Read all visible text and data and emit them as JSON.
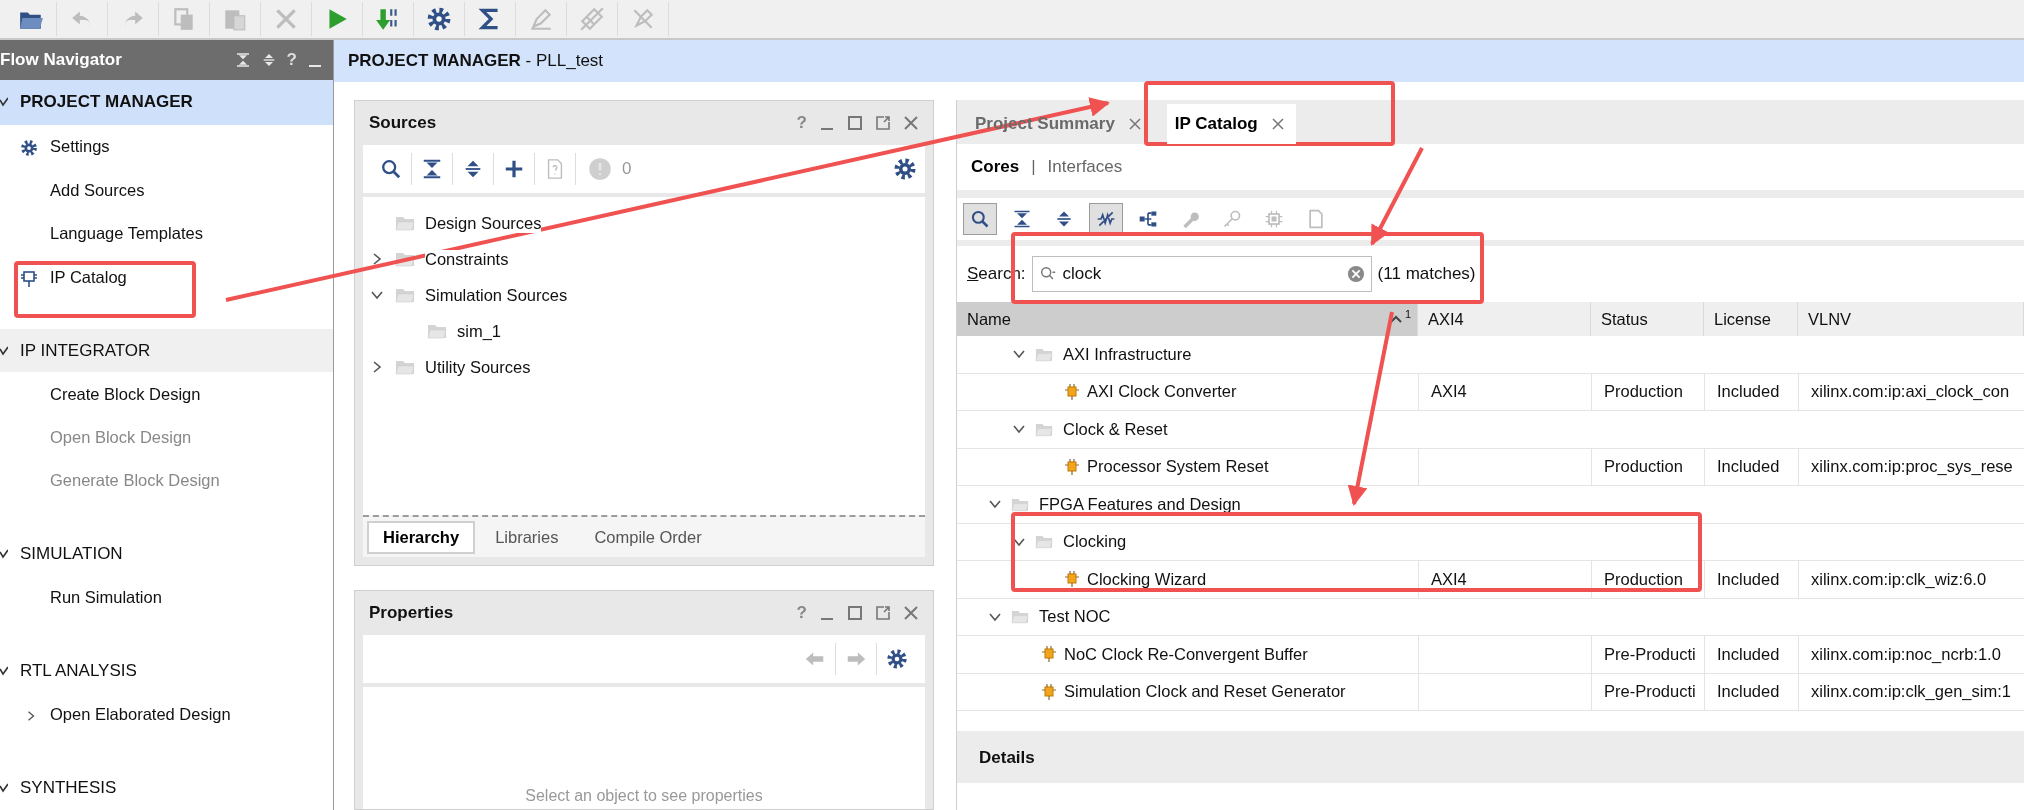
{
  "toolbar": [
    {
      "kind": "folder",
      "disabled": false
    },
    {
      "kind": "undo",
      "disabled": true
    },
    {
      "kind": "redo",
      "disabled": true
    },
    {
      "kind": "copy",
      "disabled": true
    },
    {
      "kind": "paste",
      "disabled": true
    },
    {
      "kind": "delete",
      "disabled": true
    },
    {
      "kind": "run",
      "disabled": false
    },
    {
      "kind": "bitstream",
      "disabled": false
    },
    {
      "kind": "settings",
      "disabled": false
    },
    {
      "kind": "sigma",
      "disabled": false
    },
    {
      "kind": "edit",
      "disabled": true
    },
    {
      "kind": "tag",
      "disabled": true
    },
    {
      "kind": "cut",
      "disabled": true
    }
  ],
  "flow_navigator": {
    "title": "Flow Navigator",
    "help": "?",
    "sections": [
      {
        "title": "PROJECT MANAGER",
        "expanded": true,
        "selected": true,
        "hovered": false,
        "items": [
          {
            "label": "Settings",
            "kind": "settings",
            "disabled": false
          },
          {
            "label": "Add Sources",
            "kind": "action",
            "disabled": false
          },
          {
            "label": "Language Templates",
            "kind": "action",
            "disabled": false
          },
          {
            "label": "IP Catalog",
            "kind": "catalog",
            "disabled": false
          }
        ]
      },
      {
        "title": "IP INTEGRATOR",
        "expanded": true,
        "selected": false,
        "hovered": true,
        "items": [
          {
            "label": "Create Block Design",
            "kind": "action",
            "disabled": false
          },
          {
            "label": "Open Block Design",
            "kind": "action",
            "disabled": true
          },
          {
            "label": "Generate Block Design",
            "kind": "action",
            "disabled": true
          }
        ]
      },
      {
        "title": "SIMULATION",
        "expanded": true,
        "selected": false,
        "hovered": false,
        "items": [
          {
            "label": "Run Simulation",
            "kind": "action",
            "disabled": false
          }
        ]
      },
      {
        "title": "RTL ANALYSIS",
        "expanded": true,
        "selected": false,
        "hovered": false,
        "items": [
          {
            "label": "Open Elaborated Design",
            "kind": "action",
            "disabled": false,
            "expanded": false
          }
        ]
      },
      {
        "title": "SYNTHESIS",
        "expanded": true,
        "selected": false,
        "hovered": false
      }
    ]
  },
  "header": {
    "title": "**PROJECT MANAGER** - PLL_test"
  },
  "sources": {
    "title": "Sources",
    "help": "?",
    "toolbar": [
      {
        "kind": "search",
        "disabled": false
      },
      {
        "kind": "collapse",
        "disabled": false
      },
      {
        "kind": "expand",
        "disabled": false
      },
      {
        "kind": "add",
        "disabled": false
      },
      {
        "kind": "unknown",
        "disabled": true
      }
    ],
    "message_count": "0",
    "tree": [
      {
        "label": "Design Sources"
      },
      {
        "label": "Constraints",
        "expanded": false
      },
      {
        "label": "Simulation Sources",
        "expanded": true,
        "children": [
          {
            "label": "sim_1"
          }
        ]
      },
      {
        "label": "Utility Sources",
        "expanded": false
      }
    ],
    "tabs": [
      {
        "label": "Hierarchy",
        "selected": true
      },
      {
        "label": "Libraries",
        "selected": false
      },
      {
        "label": "Compile Order",
        "selected": false
      }
    ]
  },
  "properties": {
    "title": "Properties",
    "help": "?",
    "toolbar": [
      {
        "kind": "back",
        "disabled": true
      },
      {
        "kind": "forward",
        "disabled": true
      }
    ],
    "message": "Select an object to see properties"
  },
  "ip_catalog": {
    "tabs": [
      {
        "label": "Project Summary",
        "selected": false
      },
      {
        "label": "IP Catalog",
        "selected": true
      }
    ],
    "views": [
      {
        "label": "Cores",
        "selected": true
      },
      {
        "label": "Interfaces",
        "selected": false
      }
    ],
    "view_separator": "|",
    "toolbar": [
      {
        "kind": "search",
        "on": true,
        "disabled": false
      },
      {
        "kind": "collapse",
        "on": false,
        "disabled": false
      },
      {
        "kind": "expand",
        "on": false,
        "disabled": false
      },
      {
        "kind": "filter",
        "on": true,
        "disabled": false
      },
      {
        "kind": "hierarchy",
        "on": false,
        "disabled": false
      },
      {
        "kind": "wrench",
        "on": false,
        "disabled": true
      },
      {
        "kind": "key",
        "on": false,
        "disabled": true
      },
      {
        "kind": "chip",
        "on": false,
        "disabled": true
      },
      {
        "kind": "document",
        "on": false,
        "disabled": true
      }
    ],
    "search": {
      "label": "Search:",
      "value": "clock",
      "matches": "(11 matches)"
    },
    "table": {
      "columns": [
        {
          "label": "Name",
          "sorted": true,
          "sort_index": "1"
        },
        {
          "label": "AXI4",
          "sorted": false
        },
        {
          "label": "Status",
          "sorted": false
        },
        {
          "label": "License",
          "sorted": false
        },
        {
          "label": "VLNV",
          "sorted": false
        }
      ],
      "rows": [
        {
          "kind": "scrolled_parent",
          "children": [
            {
              "kind": "category",
              "label": "AXI Infrastructure",
              "expanded": true,
              "children": [
                {
                  "kind": "ip",
                  "label": "AXI Clock Converter",
                  "axi4": "AXI4",
                  "status": "Production",
                  "license": "Included",
                  "vlnv": "xilinx.com:ip:axi_clock_con"
                }
              ]
            },
            {
              "kind": "category",
              "label": "Clock & Reset",
              "expanded": true,
              "children": [
                {
                  "kind": "ip",
                  "label": "Processor System Reset",
                  "status": "Production",
                  "license": "Included",
                  "vlnv": "xilinx.com:ip:proc_sys_rese"
                }
              ]
            }
          ]
        },
        {
          "kind": "category",
          "label": "FPGA Features and Design",
          "expanded": true,
          "children": [
            {
              "kind": "category",
              "label": "Clocking",
              "expanded": true,
              "children": [
                {
                  "kind": "ip",
                  "label": "Clocking Wizard",
                  "axi4": "AXI4",
                  "status": "Production",
                  "license": "Included",
                  "vlnv": "xilinx.com:ip:clk_wiz:6.0"
                }
              ]
            }
          ]
        },
        {
          "kind": "category",
          "label": "Test NOC",
          "expanded": true,
          "children": [
            {
              "kind": "ip",
              "label": "NoC Clock Re-Convergent Buffer",
              "status": "Pre-Producti",
              "license": "Included",
              "vlnv": "xilinx.com:ip:noc_ncrb:1.0"
            },
            {
              "kind": "ip",
              "label": "Simulation Clock and Reset Generator",
              "status": "Pre-Producti",
              "license": "Included",
              "vlnv": "xilinx.com:ip:clk_gen_sim:1"
            }
          ]
        }
      ]
    },
    "details": {
      "title": "Details"
    }
  }
}
